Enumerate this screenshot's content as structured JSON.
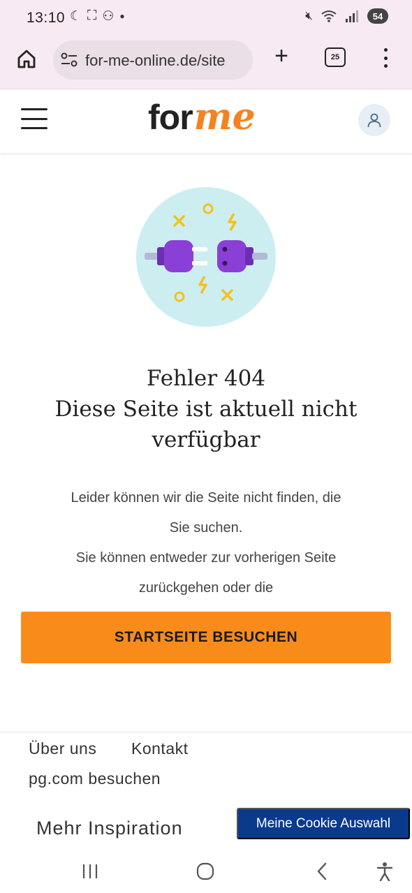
{
  "status_bar": {
    "time": "13:10",
    "battery": "54",
    "icons_left": [
      "moon-icon",
      "screenshot-icon",
      "notification-icon",
      "dot"
    ],
    "icons_right": [
      "mute-icon",
      "wifi-icon",
      "signal-icon"
    ]
  },
  "browser": {
    "url": "for-me-online.de/site",
    "tab_count": "25"
  },
  "header": {
    "logo_for": "for",
    "logo_me": "me"
  },
  "colors": {
    "brand_orange": "#f98b1a",
    "cookie_blue": "#0a3a8c",
    "illustration_bg": "#cdeef1",
    "plug_purple": "#8a3fd6"
  },
  "main": {
    "title": "Fehler 404",
    "subtitle": "Diese Seite ist aktuell nicht verfügbar",
    "text_line1": "Leider können wir die Seite nicht finden, die",
    "text_line2": "Sie suchen.",
    "text_line3": "Sie können entweder zur vorherigen Seite",
    "text_line4": "zurückgehen oder die",
    "cta_label": "STARTSEITE BESUCHEN"
  },
  "footer": {
    "about": "Über uns",
    "contact": "Kontakt",
    "pg_link": "pg.com besuchen",
    "more": "Mehr Inspiration",
    "cookie_button": "Meine Cookie Auswahl"
  }
}
